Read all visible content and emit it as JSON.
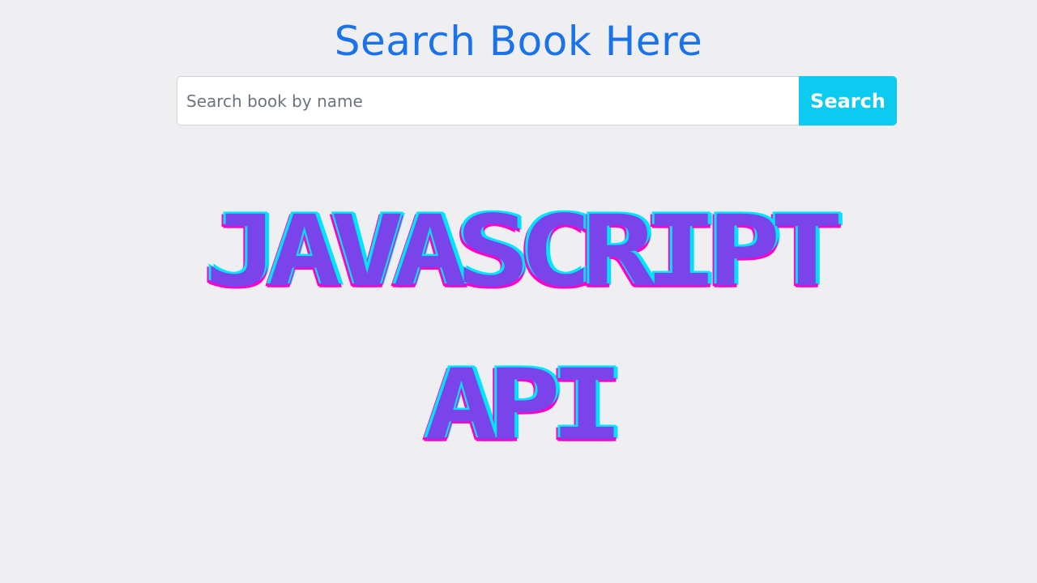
{
  "header": {
    "title": "Search Book Here"
  },
  "search": {
    "placeholder": "Search book by name",
    "value": "",
    "button_label": "Search"
  },
  "hero": {
    "line1": "JAVASCRIPT",
    "line2": "API"
  },
  "colors": {
    "title": "#1a73e8",
    "button": "#0dcaf0",
    "hero_fill": "#7a44ea",
    "hero_outline_cyan": "#00e5ff",
    "hero_outline_magenta": "#ff00c8",
    "background": "#efeff1"
  }
}
